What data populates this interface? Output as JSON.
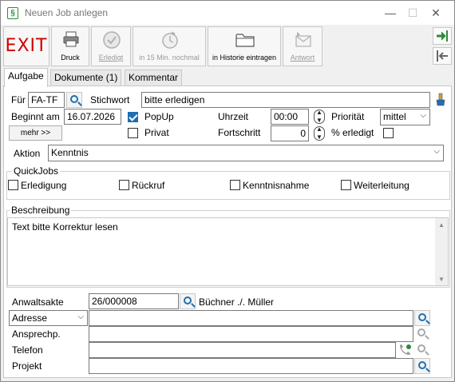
{
  "window": {
    "title": "Neuen Job anlegen",
    "controls": {
      "minimize": "—",
      "maximize": "☐",
      "close": "✕"
    }
  },
  "toolbar": {
    "exit": "EXIT",
    "druck": "Druck",
    "erledigt": "Erledigt",
    "nochmal": "in 15 Min. nochmal",
    "historie": "in Historie eintragen",
    "antwort": "Antwort"
  },
  "tabs": [
    "Aufgabe",
    "Dokumente (1)",
    "Kommentar"
  ],
  "form": {
    "fuer_label": "Für",
    "fuer_value": "FA-TF",
    "stichwort_label": "Stichwort",
    "stichwort_value": "bitte erledigen",
    "beginnt_label": "Beginnt am",
    "beginnt_value": "16.07.2026",
    "mehr_label": "mehr >>",
    "popup_label": "PopUp",
    "popup_checked": true,
    "privat_label": "Privat",
    "privat_checked": false,
    "uhrzeit_label": "Uhrzeit",
    "uhrzeit_value": "00:00",
    "fortschritt_label": "Fortschritt",
    "fortschritt_value": "0",
    "prioritaet_label": "Priorität",
    "prioritaet_value": "mittel",
    "erledigt_label": "% erledigt",
    "erledigt_checked": false,
    "aktion_label": "Aktion",
    "aktion_value": "Kenntnis"
  },
  "quickjobs": {
    "title": "QuickJobs",
    "items": [
      {
        "label": "Erledigung",
        "checked": false
      },
      {
        "label": "Rückruf",
        "checked": false
      },
      {
        "label": "Kenntnisnahme",
        "checked": false
      },
      {
        "label": "Weiterleitung",
        "checked": false
      }
    ]
  },
  "beschreibung": {
    "title": "Beschreibung",
    "text": "Text bitte Korrektur lesen"
  },
  "bottom": {
    "anwaltsakte_label": "Anwaltsakte",
    "anwaltsakte_value": "26/000008",
    "anwaltsakte_name": "Büchner ./. Müller",
    "adresse_label": "Adresse",
    "ansprechp_label": "Ansprechp.",
    "telefon_label": "Telefon",
    "projekt_label": "Projekt"
  },
  "colors": {
    "exit": "#d10000",
    "accent": "#1f6fb2",
    "nav_green": "#2e8b3a"
  }
}
